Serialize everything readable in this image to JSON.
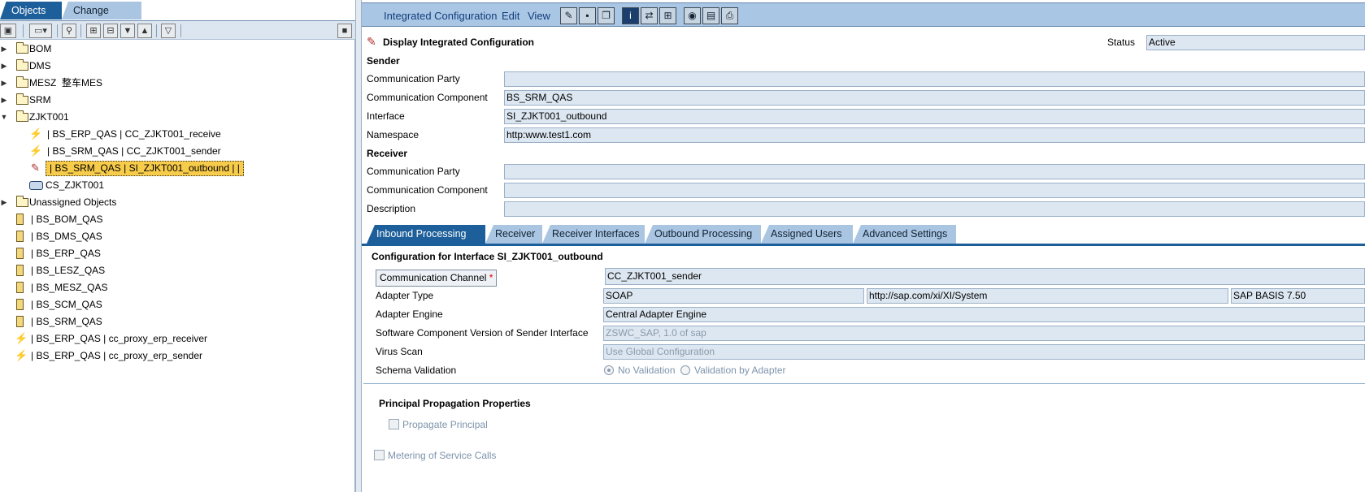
{
  "left_tabs": {
    "objects": "Objects",
    "change_lists": "Change Lists"
  },
  "tree": [
    {
      "label": "BOM"
    },
    {
      "label": "DMS"
    },
    {
      "label": "MESZ  整车MES"
    },
    {
      "label": "SRM"
    },
    {
      "label": "ZJKT001"
    },
    {
      "label": "| BS_ERP_QAS | CC_ZJKT001_receive"
    },
    {
      "label": "| BS_SRM_QAS | CC_ZJKT001_sender"
    },
    {
      "label": "| BS_SRM_QAS | SI_ZJKT001_outbound |  |"
    },
    {
      "label": "CS_ZJKT001"
    },
    {
      "label": "Unassigned Objects"
    },
    {
      "label": "| BS_BOM_QAS"
    },
    {
      "label": "| BS_DMS_QAS"
    },
    {
      "label": "| BS_ERP_QAS"
    },
    {
      "label": "| BS_LESZ_QAS"
    },
    {
      "label": "| BS_MESZ_QAS"
    },
    {
      "label": "| BS_SCM_QAS"
    },
    {
      "label": "| BS_SRM_QAS"
    },
    {
      "label": "| BS_ERP_QAS | cc_proxy_erp_receiver"
    },
    {
      "label": "| BS_ERP_QAS | cc_proxy_erp_sender"
    }
  ],
  "menu": {
    "integrated_configuration": "Integrated Configuration",
    "edit": "Edit",
    "view": "View"
  },
  "header": {
    "title": "Display Integrated Configuration",
    "status_label": "Status",
    "status_value": "Active"
  },
  "sender": {
    "heading": "Sender",
    "party_label": "Communication Party",
    "party_value": "",
    "component_label": "Communication Component",
    "component_value": "BS_SRM_QAS",
    "interface_label": "Interface",
    "interface_value": "SI_ZJKT001_outbound",
    "namespace_label": "Namespace",
    "namespace_value": "http:www.test1.com"
  },
  "receiver": {
    "heading": "Receiver",
    "party_label": "Communication Party",
    "party_value": "",
    "component_label": "Communication Component",
    "component_value": "",
    "description_label": "Description",
    "description_value": ""
  },
  "tabs": [
    "Inbound Processing",
    "Receiver",
    "Receiver Interfaces",
    "Outbound Processing",
    "Assigned Users",
    "Advanced Settings"
  ],
  "inbound": {
    "heading": "Configuration for Interface SI_ZJKT001_outbound",
    "channel_button": "Communication Channel",
    "required_mark": "*",
    "channel_value": "CC_ZJKT001_sender",
    "adapter_type_label": "Adapter Type",
    "adapter_type_value": "SOAP",
    "adapter_namespace": "http://sap.com/xi/XI/System",
    "adapter_swcv": "SAP BASIS 7.50",
    "adapter_engine_label": "Adapter Engine",
    "adapter_engine_value": "Central Adapter Engine",
    "swcv_label": "Software Component Version of Sender Interface",
    "swcv_value": "ZSWC_SAP, 1.0 of sap",
    "virus_label": "Virus Scan",
    "virus_value": "Use Global Configuration",
    "schema_label": "Schema Validation",
    "schema_opt1": "No Validation",
    "schema_opt2": "Validation by Adapter",
    "principal_heading": "Principal Propagation Properties",
    "propagate_label": "Propagate Principal",
    "metering_label": "Metering of Service Calls"
  }
}
